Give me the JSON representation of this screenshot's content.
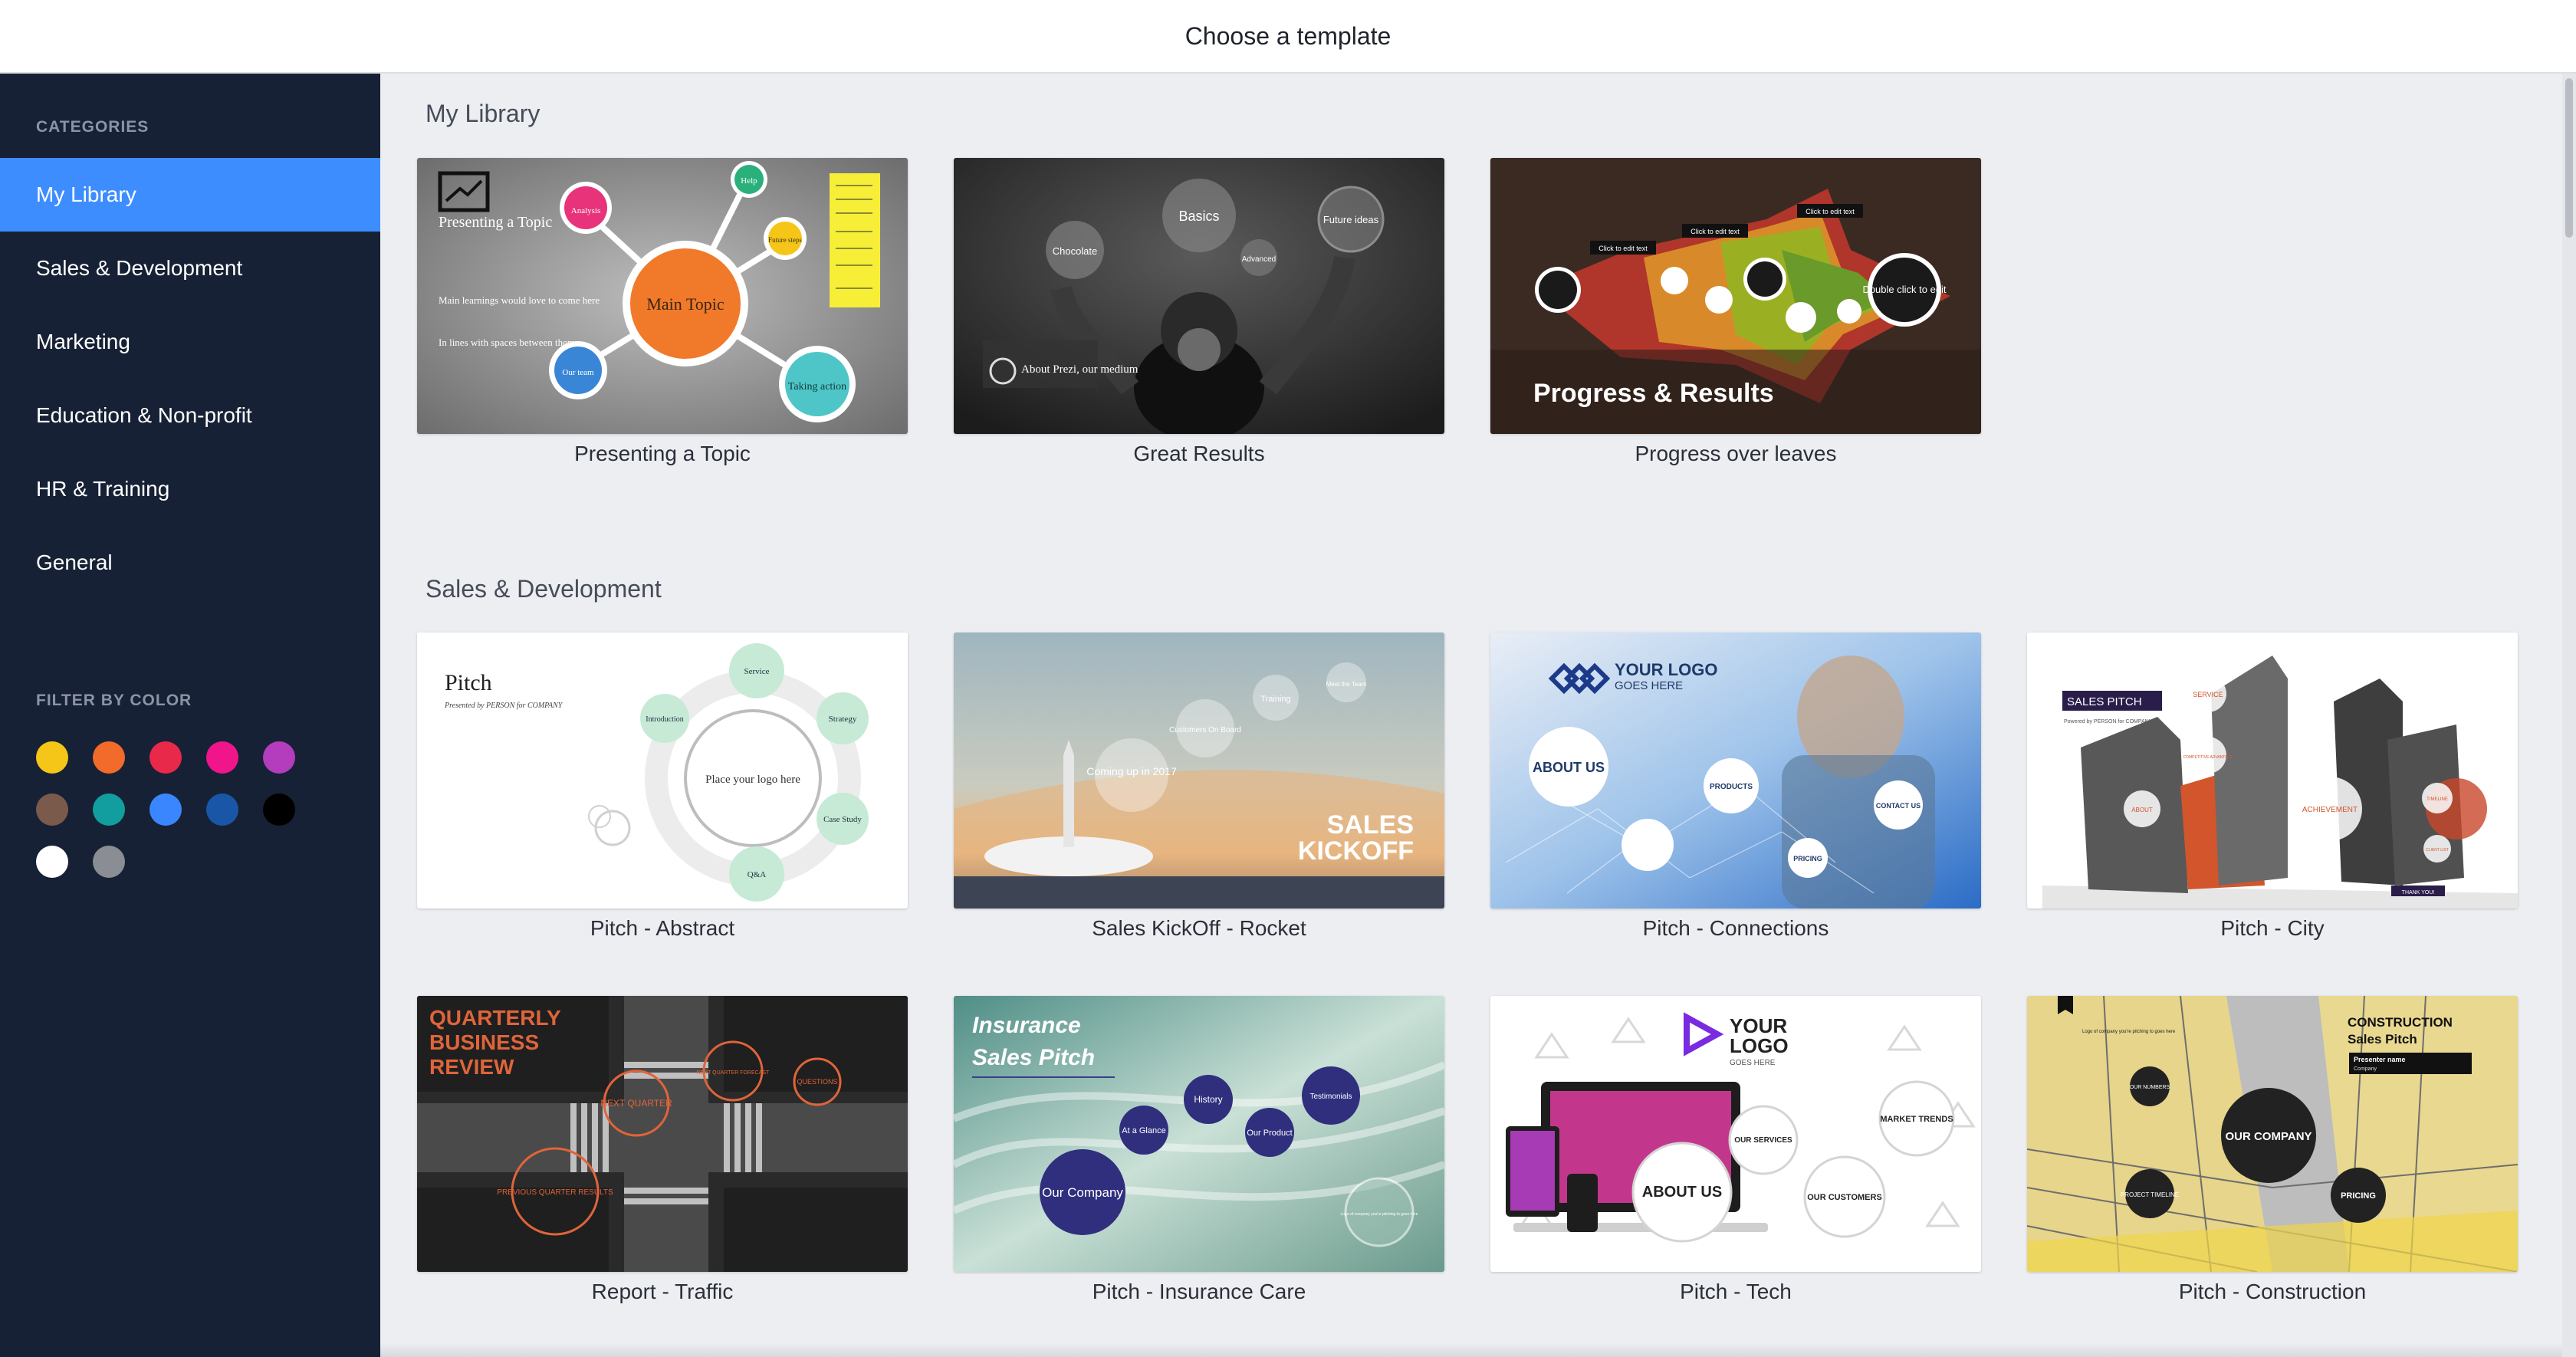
{
  "header": {
    "title": "Choose a template"
  },
  "sidebar": {
    "categories_label": "CATEGORIES",
    "items": [
      {
        "label": "My Library",
        "active": true
      },
      {
        "label": "Sales & Development",
        "active": false
      },
      {
        "label": "Marketing",
        "active": false
      },
      {
        "label": "Education & Non-profit",
        "active": false
      },
      {
        "label": "HR & Training",
        "active": false
      },
      {
        "label": "General",
        "active": false
      }
    ],
    "filter_label": "FILTER BY COLOR",
    "colors": [
      "#f5c518",
      "#f26b2a",
      "#e8294a",
      "#f0158a",
      "#b33dbd",
      "#7a5a4a",
      "#129e9e",
      "#3a86ff",
      "#1a56a8",
      "#000000",
      "#ffffff",
      "#8a8d93"
    ]
  },
  "sections": [
    {
      "title": "My Library",
      "cards": [
        {
          "label": "Presenting a Topic",
          "thumb": {
            "title": "Presenting a Topic",
            "center": "Main Topic",
            "nodes": [
              "Analysis",
              "Help",
              "Future steps",
              "Our team",
              "Taking action"
            ],
            "notes": [
              "Main learnings would love to come here",
              "In lines with spaces between them"
            ]
          }
        },
        {
          "label": "Great Results",
          "thumb": {
            "bubbles": [
              "Basics",
              "Chocolate",
              "Future ideas",
              "Advanced"
            ],
            "caption": "About Prezi, our medium"
          }
        },
        {
          "label": "Progress over leaves",
          "thumb": {
            "title": "Progress & Results",
            "tags": [
              "Click to edit text",
              "Click to edit text",
              "Click to edit text"
            ],
            "circle_text": "Double click to edit"
          }
        }
      ]
    },
    {
      "title": "Sales & Development",
      "cards": [
        {
          "label": "Pitch - Abstract",
          "thumb": {
            "title": "Pitch",
            "subtitle": "Presented by PERSON for COMPANY",
            "center": "Place your logo here",
            "nodes": [
              "Service",
              "Strategy",
              "Case Study",
              "Q&A",
              "Introduction"
            ]
          }
        },
        {
          "label": "Sales KickOff - Rocket",
          "thumb": {
            "title_line1": "SALES",
            "title_line2": "KICKOFF",
            "bubbles": [
              "Coming up in 2017",
              "Customers On Board",
              "Training",
              "Meet the Team"
            ]
          }
        },
        {
          "label": "Pitch - Connections",
          "thumb": {
            "logo_line1": "YOUR LOGO",
            "logo_line2": "GOES HERE",
            "nodes": [
              "ABOUT US",
              "PRODUCTS",
              "CONTACT US",
              "PRICING"
            ]
          }
        },
        {
          "label": "Pitch - City",
          "thumb": {
            "title": "SALES PITCH",
            "subtitle": "Powered by PERSON for COMPANY",
            "nodes": [
              "SERVICE",
              "COMPETITIVE ADVANTAGE",
              "ABOUT",
              "ACHIEVEMENT",
              "TIMELINE",
              "CLIENT LIST"
            ],
            "footer": "THANK YOU!"
          }
        },
        {
          "label": "Report - Traffic",
          "thumb": {
            "title": [
              "QUARTERLY",
              "BUSINESS",
              "REVIEW"
            ],
            "nodes": [
              "NEXT QUARTER",
              "NEXT QUARTER FORECAST",
              "QUESTIONS",
              "PREVIOUS QUARTER RESULTS"
            ]
          }
        },
        {
          "label": "Pitch - Insurance Care",
          "thumb": {
            "title_line1": "Insurance",
            "title_line2": "Sales Pitch",
            "nodes": [
              "Our Company",
              "At a Glance",
              "History",
              "Our Product",
              "Testimonials",
              "Logo of company you're pitching to goes here"
            ]
          }
        },
        {
          "label": "Pitch - Tech",
          "thumb": {
            "logo_line1": "YOUR",
            "logo_line2": "LOGO",
            "logo_line3": "GOES HERE",
            "nodes": [
              "ABOUT US",
              "OUR SERVICES",
              "OUR CUSTOMERS",
              "MARKET TRENDS"
            ]
          }
        },
        {
          "label": "Pitch - Construction",
          "thumb": {
            "title_line1": "CONSTRUCTION",
            "title_line2": "Sales Pitch",
            "presenter": "Presenter name",
            "company": "Company",
            "nodes": [
              "OUR COMPANY",
              "OUR NUMBERS",
              "PROJECT TIMELINE",
              "PRICING"
            ],
            "note": "Logo of company you're pitching to goes here"
          }
        }
      ]
    }
  ]
}
